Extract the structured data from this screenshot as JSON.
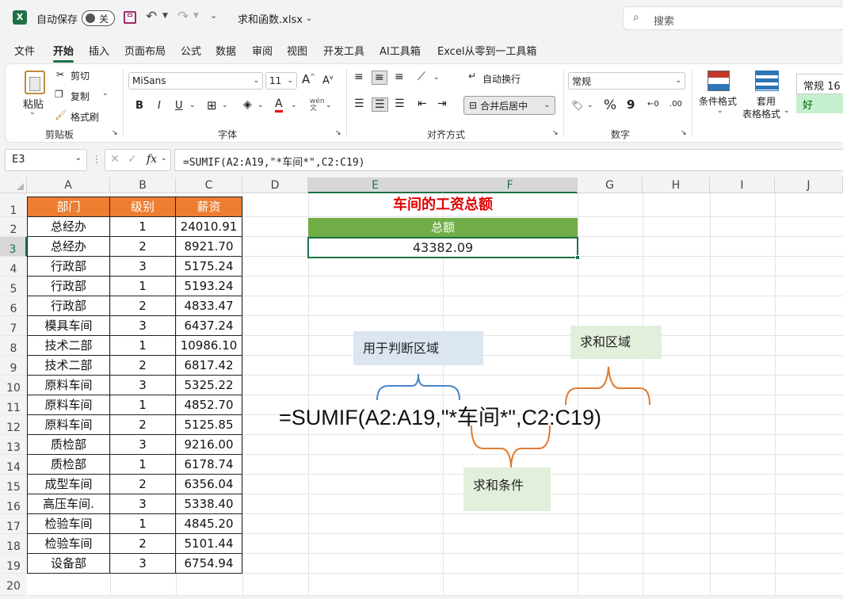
{
  "titlebar": {
    "autosave_label": "自动保存",
    "autosave_state": "关",
    "filename": "求和函数.xlsx",
    "search_placeholder": "搜索"
  },
  "menu": [
    "文件",
    "开始",
    "插入",
    "页面布局",
    "公式",
    "数据",
    "审阅",
    "视图",
    "开发工具",
    "AI工具箱",
    "Excel从零到一工具箱"
  ],
  "ribbon": {
    "clipboard": {
      "paste": "粘贴",
      "cut": "剪切",
      "copy": "复制",
      "format_painter": "格式刷",
      "label": "剪贴板"
    },
    "font": {
      "name": "MiSans",
      "size": "11",
      "label": "字体",
      "grow": "A",
      "shrink": "A"
    },
    "alignment": {
      "wrap": "自动换行",
      "merge": "合并后居中",
      "label": "对齐方式"
    },
    "number": {
      "format": "常规",
      "percent": "%",
      "comma": "9",
      "label": "数字",
      "inc": "←0",
      "dec": ".00"
    },
    "styles": {
      "conditional": "条件格式",
      "table_format_1": "套用",
      "table_format_2": "表格格式",
      "normal": "常规 16",
      "good": "好"
    }
  },
  "formula_bar": {
    "name_box": "E3",
    "fx": "fx",
    "formula": "=SUMIF(A2:A19,\"*车间*\",C2:C19)"
  },
  "columns": [
    "A",
    "B",
    "C",
    "D",
    "E",
    "F",
    "G",
    "H",
    "I",
    "J"
  ],
  "rows": [
    "1",
    "2",
    "3",
    "4",
    "5",
    "6",
    "7",
    "8",
    "9",
    "10",
    "11",
    "12",
    "13",
    "14",
    "15",
    "16",
    "17",
    "18",
    "19",
    "20"
  ],
  "table": {
    "headers": [
      "部门",
      "级别",
      "薪资"
    ],
    "data": [
      [
        "总经办",
        "1",
        "24010.91"
      ],
      [
        "总经办",
        "2",
        "8921.70"
      ],
      [
        "行政部",
        "3",
        "5175.24"
      ],
      [
        "行政部",
        "1",
        "5193.24"
      ],
      [
        "行政部",
        "2",
        "4833.47"
      ],
      [
        "模具车间",
        "3",
        "6437.24"
      ],
      [
        "技术二部",
        "1",
        "10986.10"
      ],
      [
        "技术二部",
        "2",
        "6817.42"
      ],
      [
        "原料车间",
        "3",
        "5325.22"
      ],
      [
        "原料车间",
        "1",
        "4852.70"
      ],
      [
        "原料车间",
        "2",
        "5125.85"
      ],
      [
        "质检部",
        "3",
        "9216.00"
      ],
      [
        "质检部",
        "1",
        "6178.74"
      ],
      [
        "成型车间",
        "2",
        "6356.04"
      ],
      [
        "高压车间.",
        "3",
        "5338.40"
      ],
      [
        "检验车间",
        "1",
        "4845.20"
      ],
      [
        "检验车间",
        "2",
        "5101.44"
      ],
      [
        "设备部",
        "3",
        "6754.94"
      ]
    ]
  },
  "summary": {
    "title": "车间的工资总额",
    "header": "总额",
    "value": "43382.09"
  },
  "annotation": {
    "formula": "=SUMIF(A2:A19,\"*车间*\",C2:C19)",
    "range_label": "用于判断区域",
    "sum_range_label": "求和区域",
    "criteria_label": "求和条件"
  },
  "colors": {
    "excel_green": "#1e7145",
    "header_orange": "#ed7d31",
    "summary_green": "#70ad47",
    "title_red": "#e00000",
    "note_blue": "#dce6f1",
    "note_green": "#e2efda",
    "brace_blue": "#4a86c8",
    "brace_orange": "#e07b30"
  }
}
